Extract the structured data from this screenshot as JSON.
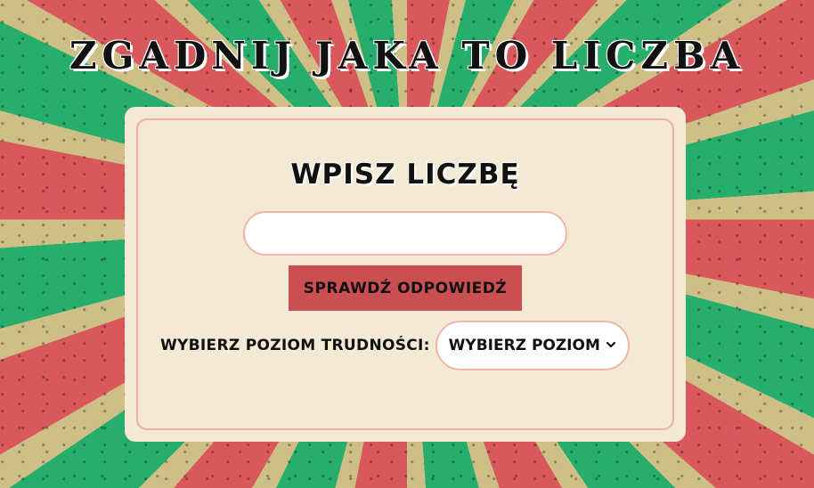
{
  "header": {
    "title": "Zgadnij jaka to liczba"
  },
  "card": {
    "heading": "Wpisz liczbę",
    "input": {
      "value": "",
      "placeholder": ""
    },
    "check_button_label": "Sprawdź odpowiedź",
    "level_label": "Wybierz poziom trudności:",
    "level_select": {
      "selected": "Wybierz poziom",
      "icon": "chevron-down-icon"
    }
  },
  "colors": {
    "red_ray": "#d9585b",
    "green_ray": "#27ad6c",
    "sand_ray": "#cdbf86",
    "ticket": "#f3e9d4",
    "ticket_border": "#efb1a6",
    "button": "#c94f50"
  }
}
